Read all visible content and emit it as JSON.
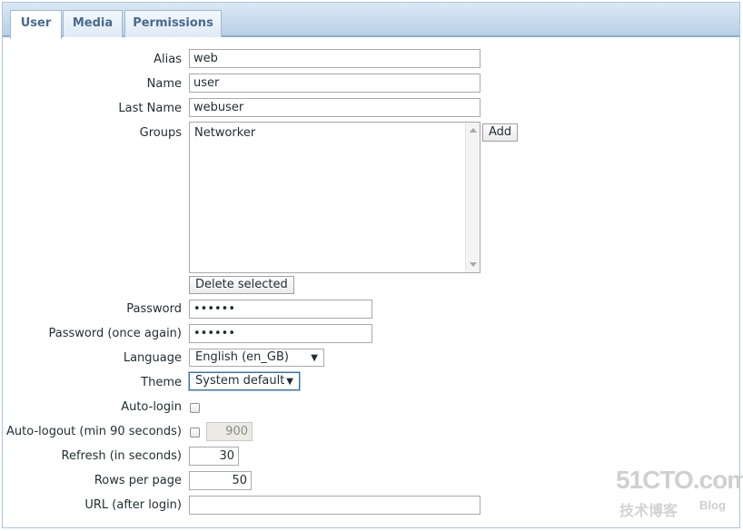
{
  "tabs": [
    {
      "label": "User",
      "active": true
    },
    {
      "label": "Media",
      "active": false
    },
    {
      "label": "Permissions",
      "active": false
    }
  ],
  "form": {
    "alias": {
      "label": "Alias",
      "value": "web"
    },
    "name": {
      "label": "Name",
      "value": "user"
    },
    "last_name": {
      "label": "Last Name",
      "value": "webuser"
    },
    "groups": {
      "label": "Groups",
      "items": [
        "Networker"
      ],
      "add_label": "Add",
      "delete_label": "Delete selected"
    },
    "password": {
      "label": "Password",
      "value": "••••••"
    },
    "password_again": {
      "label": "Password (once again)",
      "value": "••••••"
    },
    "language": {
      "label": "Language",
      "selected": "English (en_GB)"
    },
    "theme": {
      "label": "Theme",
      "selected": "System default"
    },
    "auto_login": {
      "label": "Auto-login",
      "checked": false
    },
    "auto_logout": {
      "label": "Auto-logout (min 90 seconds)",
      "checked": false,
      "value": "900"
    },
    "refresh": {
      "label": "Refresh (in seconds)",
      "value": "30"
    },
    "rows_per_page": {
      "label": "Rows per page",
      "value": "50"
    },
    "url": {
      "label": "URL (after login)",
      "value": ""
    }
  },
  "watermark": {
    "main": "51CTO.com",
    "sub": "技术博客",
    "blog": "Blog"
  },
  "colors": {
    "tab_text": "#486a8f",
    "tab_border": "#9fbad6",
    "tabbar_bottom": "#8aaed0",
    "focus": "#3a6fb0"
  }
}
